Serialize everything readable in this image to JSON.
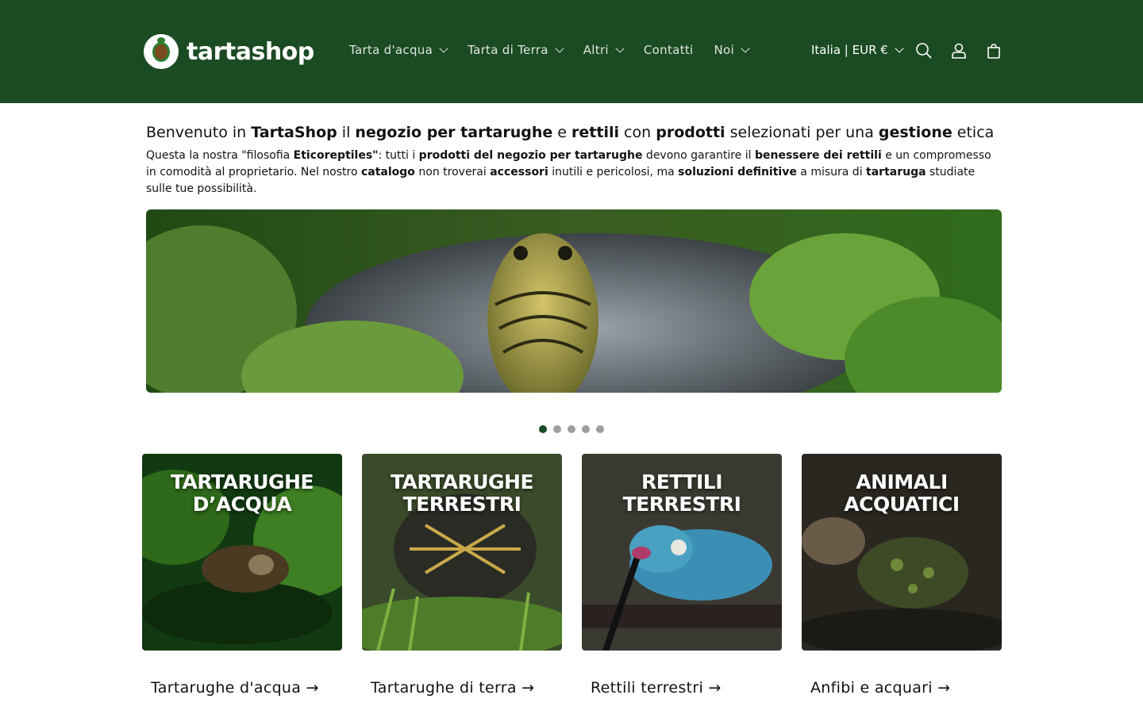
{
  "brand": {
    "name": "tartashop"
  },
  "nav": {
    "items": [
      {
        "label": "Tarta d'acqua",
        "dropdown": true
      },
      {
        "label": "Tarta di Terra",
        "dropdown": true
      },
      {
        "label": "Altri",
        "dropdown": true
      },
      {
        "label": "Contatti",
        "dropdown": false
      },
      {
        "label": "Noi",
        "dropdown": true
      }
    ],
    "country": "Italia | EUR €"
  },
  "icons": [
    "search-icon",
    "account-icon",
    "cart-icon"
  ],
  "intro": {
    "heading_parts": [
      "Benvenuto in ",
      "TartaShop",
      " il ",
      "negozio per tartarughe",
      " e ",
      "rettili",
      " con ",
      "prodotti",
      " selezionati per una ",
      "gestione",
      " etica"
    ],
    "paragraph_parts": [
      "Questa la nostra \"filosofia ",
      "Eticoreptiles\"",
      ": tutti i ",
      "prodotti del negozio per tartarughe",
      " devono garantire il ",
      "benessere dei rettili",
      " e un compromesso in comodità al proprietario. Nel nostro ",
      "catalogo",
      " non troverai ",
      "accessori",
      " inutili e pericolosi, ma ",
      "soluzioni definitive",
      " a misura di ",
      "tartaruga",
      " studiate sulle tue possibilità."
    ]
  },
  "slideshow": {
    "slide_count": 5,
    "active_index": 0
  },
  "categories": [
    {
      "image_title": "TARTARUGHE D'ACQUA",
      "image_title_lines": [
        "TARTARUGHE",
        "D’ACQUA"
      ],
      "label": "Tartarughe d'acqua →"
    },
    {
      "image_title": "TARTARUGHE TERRESTRI",
      "image_title_lines": [
        "TARTARUGHE",
        "TERRESTRI"
      ],
      "label": "Tartarughe di terra →"
    },
    {
      "image_title": "RETTILI TERRESTRI",
      "image_title_lines": [
        "RETTILI",
        "TERRESTRI"
      ],
      "label": "Rettili terrestri →"
    },
    {
      "image_title": "ANIMALI ACQUATICI",
      "image_title_lines": [
        "ANIMALI",
        "ACQUATICI"
      ],
      "label": "Anfibi e acquari →"
    }
  ],
  "colors": {
    "header_bg": "#1b4b22",
    "accent": "#1b4b22",
    "text": "#121212"
  }
}
